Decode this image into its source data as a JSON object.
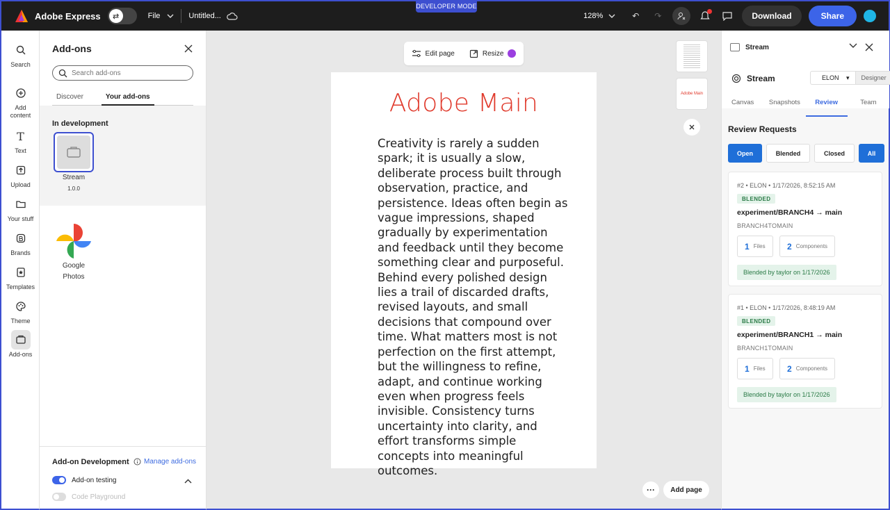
{
  "topbar": {
    "app_name": "Adobe Express",
    "file_label": "File",
    "doc_title": "Untitled...",
    "developer_mode": "DEVELOPER MODE",
    "zoom": "128%",
    "download_label": "Download",
    "share_label": "Share"
  },
  "rail": {
    "items": [
      {
        "label": "Search",
        "icon": "search-icon"
      },
      {
        "label": "Add content",
        "icon": "plus-circle-icon"
      },
      {
        "label": "Text",
        "icon": "text-icon"
      },
      {
        "label": "Upload",
        "icon": "upload-icon"
      },
      {
        "label": "Your stuff",
        "icon": "folder-icon"
      },
      {
        "label": "Brands",
        "icon": "brand-icon"
      },
      {
        "label": "Templates",
        "icon": "templates-icon"
      },
      {
        "label": "Theme",
        "icon": "palette-icon"
      },
      {
        "label": "Add-ons",
        "icon": "addons-icon"
      }
    ]
  },
  "addons": {
    "title": "Add-ons",
    "search_placeholder": "Search add-ons",
    "tab_discover": "Discover",
    "tab_yours": "Your add-ons",
    "in_development": "In development",
    "dev_addon": {
      "name": "Stream",
      "version": "1.0.0"
    },
    "google_photos_line1": "Google",
    "google_photos_line2": "Photos",
    "dev_section_title": "Add-on Development",
    "manage_label": "Manage add-ons",
    "testing_label": "Add-on testing",
    "playground_label": "Code Playground"
  },
  "canvas": {
    "edit_page": "Edit page",
    "resize": "Resize",
    "page_title": "Adobe Main",
    "page_body": "Creativity is rarely a sudden spark; it is usually a slow, deliberate process built through observation, practice, and persistence. Ideas often begin as vague impressions, shaped gradually by experimentation and feedback until they become something clear and purposeful. Behind every polished design lies a trail of discarded drafts, revised layouts, and small decisions that compound over time. What matters most is not perfection on the first attempt, but the willingness to refine, adapt, and continue working even when progress feels invisible. Consistency turns uncertainty into clarity, and effort transforms simple concepts into meaningful outcomes.",
    "thumb2_text": "Adobe Main",
    "add_page": "Add page"
  },
  "right_panel": {
    "header": "Stream",
    "plugin_name": "Stream",
    "user": "ELON",
    "role": "Designer",
    "tabs": [
      "Canvas",
      "Snapshots",
      "Review",
      "Team"
    ],
    "active_tab": "Review",
    "section_title": "Review Requests",
    "filters": [
      "Open",
      "Blended",
      "Closed",
      "All"
    ],
    "cards": [
      {
        "meta": "#2 • ELON • 1/17/2026, 8:52:15 AM",
        "badge": "BLENDED",
        "branch": "experiment/BRANCH4 → main",
        "sub": "BRANCH4TOMAIN",
        "files_count": "1",
        "files_label": "Files",
        "components_count": "2",
        "components_label": "Components",
        "blended_by": "Blended by taylor on 1/17/2026"
      },
      {
        "meta": "#1 • ELON • 1/17/2026, 8:48:19 AM",
        "badge": "BLENDED",
        "branch": "experiment/BRANCH1 → main",
        "sub": "BRANCH1TOMAIN",
        "files_count": "1",
        "files_label": "Files",
        "components_count": "2",
        "components_label": "Components",
        "blended_by": "Blended by taylor on 1/17/2026"
      }
    ]
  },
  "colors": {
    "accent": "#3d4fd0",
    "title_red": "#e0392b",
    "blue": "#1f6fd8",
    "green_badge": "#e4f3ea"
  }
}
